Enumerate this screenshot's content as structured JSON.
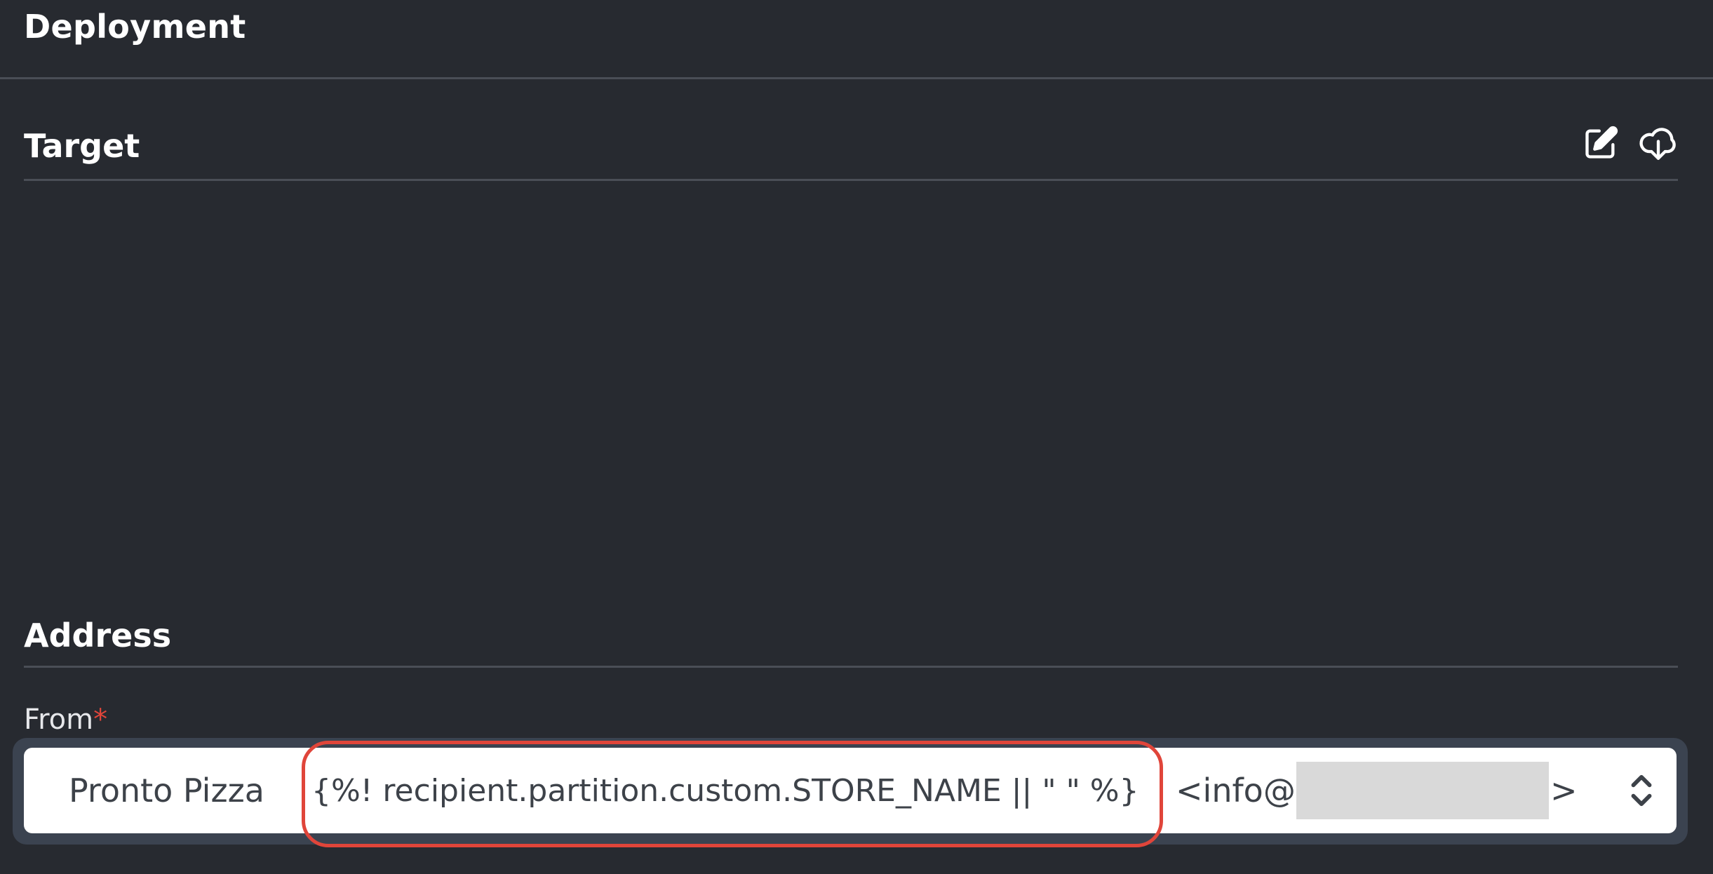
{
  "header": {
    "title": "Deployment"
  },
  "target": {
    "title": "Target",
    "edit_icon": "edit-icon",
    "download_icon": "cloud-download-icon"
  },
  "address": {
    "title": "Address",
    "from": {
      "label": "From",
      "required_mark": "*",
      "sender_name": "Pronto Pizza",
      "template_expression": "{%! recipient.partition.custom.STORE_NAME || \" \" %}",
      "email_prefix": "<info@",
      "email_suffix": ">"
    }
  },
  "colors": {
    "background": "#272a30",
    "divider": "#4a4e56",
    "required": "#e0453a",
    "highlight": "#e0453a",
    "select_border": "#3b4350"
  }
}
